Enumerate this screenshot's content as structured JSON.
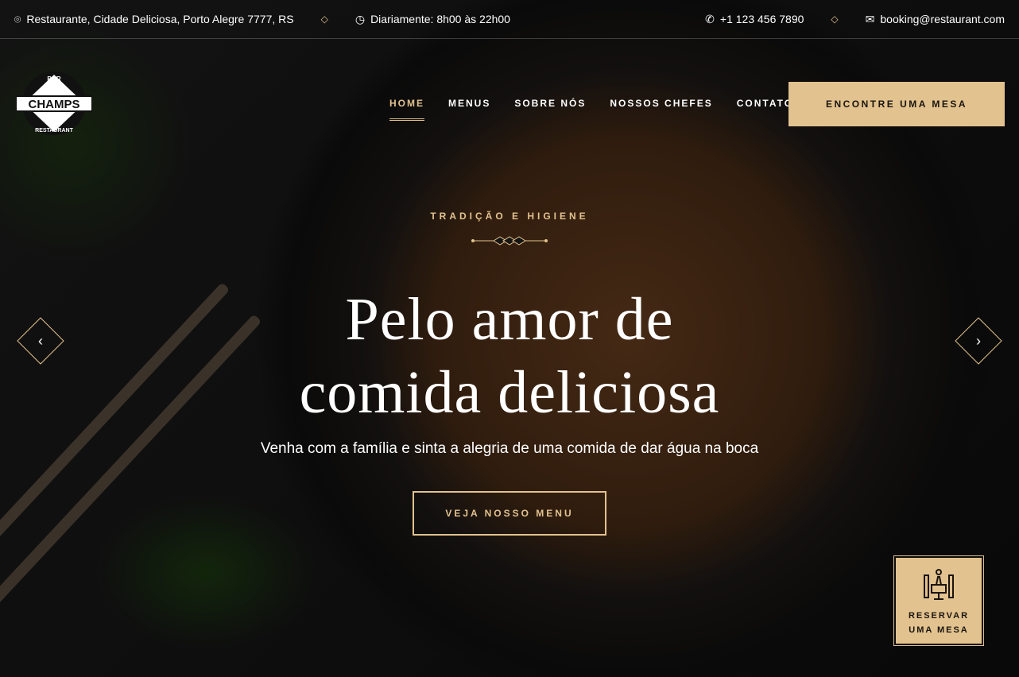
{
  "topbar": {
    "address": "Restaurante, Cidade Deliciosa, Porto Alegre 7777, RS",
    "hours": "Diariamente: 8h00 às 22h00",
    "phone": "+1 123 456 7890",
    "email": "booking@restaurant.com"
  },
  "logo": {
    "top": "BAR",
    "main": "CHAMPS",
    "bottom": "RESTAURANT"
  },
  "nav": {
    "items": [
      "HOME",
      "MENUS",
      "SOBRE NÓS",
      "NOSSOS CHEFES",
      "CONTATO"
    ],
    "active": "HOME",
    "cta": "ENCONTRE UMA MESA"
  },
  "hero": {
    "subtitle": "TRADIÇÃO E HIGIENE",
    "title_line1": "Pelo amor de",
    "title_line2": "comida deliciosa",
    "lead": "Venha com a família e sinta a alegria de uma comida de dar água na boca",
    "button": "VEJA NOSSO MENU"
  },
  "slider": {
    "prev": "‹",
    "next": "›"
  },
  "reserve": {
    "line1": "RESERVAR",
    "line2": "UMA MESA"
  },
  "colors": {
    "accent": "#e2c28e"
  }
}
